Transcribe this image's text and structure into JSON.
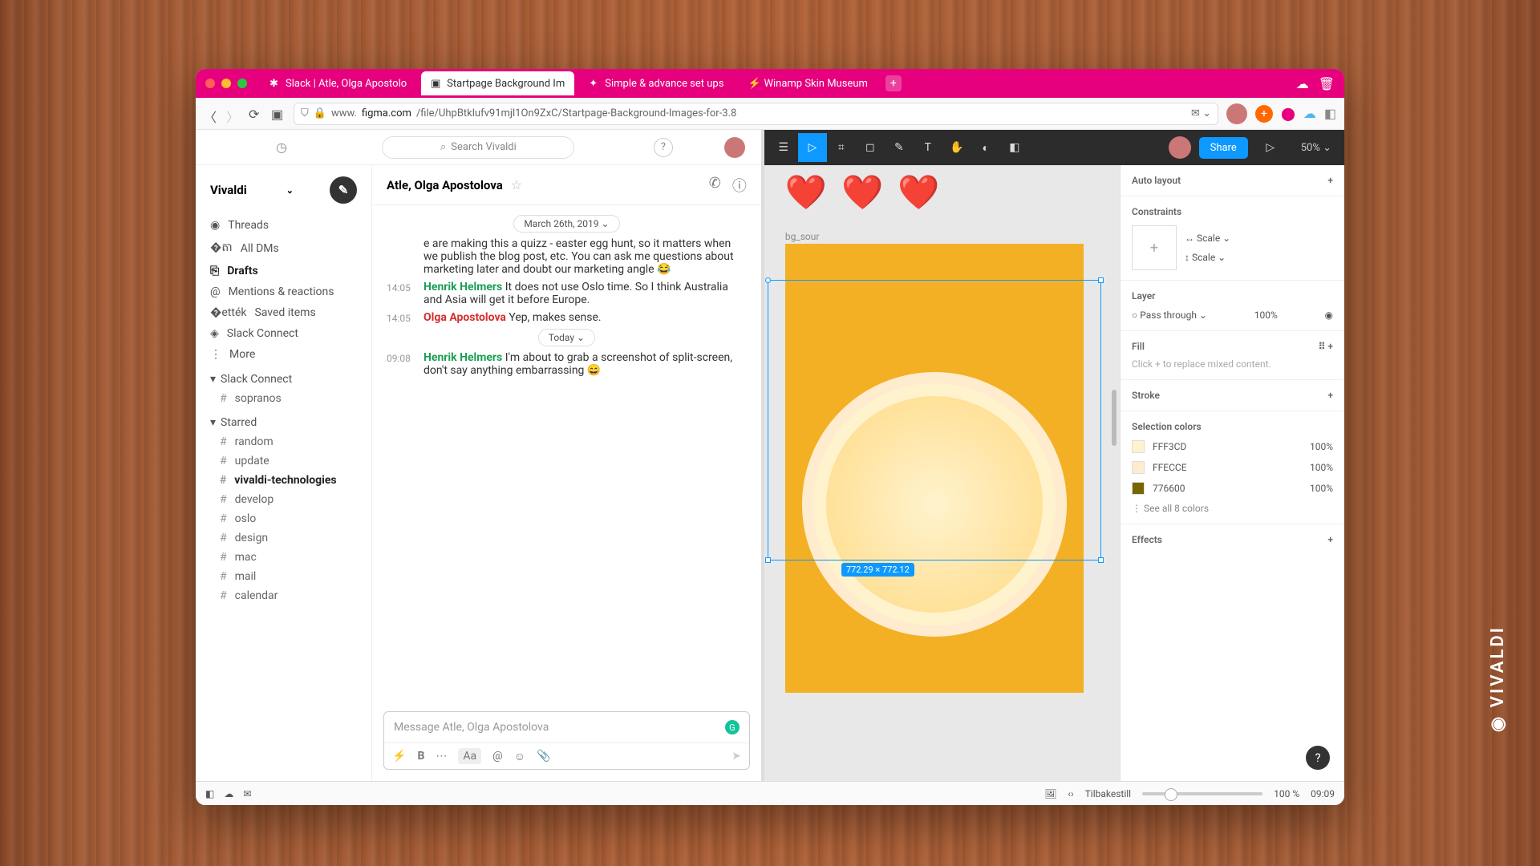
{
  "tabs": [
    {
      "label": "Slack | Atle, Olga Apostolo"
    },
    {
      "label": "Startpage Background Im"
    },
    {
      "label": "Simple & advance set ups"
    },
    {
      "label": "Winamp Skin Museum"
    }
  ],
  "url": {
    "prefix": "www.",
    "host": "figma.com",
    "path": "/file/UhpBtklufv91mjl1On9ZxC/Startpage-Background-Images-for-3.8"
  },
  "slack": {
    "search_placeholder": "Search Vivaldi",
    "workspace": "Vivaldi",
    "nav": [
      "Threads",
      "All DMs",
      "Drafts",
      "Mentions & reactions",
      "Saved items",
      "Slack Connect",
      "More"
    ],
    "sections": [
      {
        "name": "Slack Connect",
        "channels": [
          "sopranos"
        ]
      },
      {
        "name": "Starred",
        "channels": [
          "random",
          "update",
          "vivaldi-technologies",
          "develop",
          "oslo",
          "design",
          "mac",
          "mail",
          "calendar"
        ]
      }
    ],
    "chat_title": "Atle, Olga Apostolova",
    "date1": "March 26th, 2019",
    "msg1": "e are making this a quizz - easter egg hunt, so it matters when we publish the blog post, etc. You can ask me questions about marketing later and doubt our marketing angle 😂",
    "msg2": {
      "time": "14:05",
      "author": "Henrik Helmers",
      "text": "It does not use Oslo time. So I think Australia and Asia will get it before Europe."
    },
    "msg3": {
      "time": "14:05",
      "author": "Olga Apostolova",
      "text": "Yep, makes sense."
    },
    "date2": "Today",
    "msg4": {
      "time": "09:08",
      "author": "Henrik Helmers",
      "text": "I'm about to grab a screenshot of split-screen, don't say anything embarrassing 😄"
    },
    "composer_placeholder": "Message Atle, Olga Apostolova"
  },
  "figma": {
    "share": "Share",
    "zoom": "50%",
    "frame_label": "bg_sour",
    "dimensions": "772.29 × 772.12",
    "panel": {
      "auto_layout": "Auto layout",
      "constraints": "Constraints",
      "scale": "Scale",
      "layer": "Layer",
      "pass_through": "Pass through",
      "opacity": "100%",
      "fill": "Fill",
      "fill_hint": "Click + to replace mixed content.",
      "stroke": "Stroke",
      "sel_colors": "Selection colors",
      "colors": [
        {
          "hex": "FFF3CD",
          "pct": "100%"
        },
        {
          "hex": "FFECCE",
          "pct": "100%"
        },
        {
          "hex": "776600",
          "pct": "100%"
        }
      ],
      "see_all": "See all 8 colors",
      "effects": "Effects"
    }
  },
  "status": {
    "reset": "Tilbakestill",
    "zoom": "100 %",
    "time": "09:09"
  }
}
